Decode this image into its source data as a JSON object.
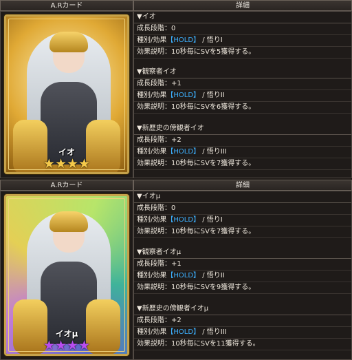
{
  "sections": [
    {
      "left_header": "A.Rカード",
      "right_header": "詳細",
      "card": {
        "name": "イオ",
        "star_count": 4,
        "star_color": "#f4c94a",
        "stars": "★★★★",
        "bg": "gold"
      },
      "details": [
        {
          "title": "▼イオ",
          "growth": "成長段階：0",
          "type_prefix": "種別/効果",
          "type_hold": "【HOLD】",
          "type_suffix": " / 悟りI",
          "effect": "効果説明：10秒毎にSVを5獲得する。"
        },
        {
          "title": "▼観察者イオ",
          "growth": "成長段階：+1",
          "type_prefix": "種別/効果",
          "type_hold": "【HOLD】",
          "type_suffix": " / 悟りII",
          "effect": "効果説明：10秒毎にSVを6獲得する。"
        },
        {
          "title": "▼新歴史の傍観者イオ",
          "growth": "成長段階：+2",
          "type_prefix": "種別/効果",
          "type_hold": "【HOLD】",
          "type_suffix": " / 悟りIII",
          "effect": "効果説明：10秒毎にSVを7獲得する。"
        }
      ]
    },
    {
      "left_header": "A.Rカード",
      "right_header": "詳細",
      "card": {
        "name": "イオμ",
        "star_count": 4,
        "star_color": "#b84df0",
        "stars": "★★★★",
        "bg": "prism"
      },
      "details": [
        {
          "title": "▼イオμ",
          "growth": "成長段階：0",
          "type_prefix": "種別/効果",
          "type_hold": "【HOLD】",
          "type_suffix": " / 悟りI",
          "effect": "効果説明：10秒毎にSVを7獲得する。"
        },
        {
          "title": "▼観察者イオμ",
          "growth": "成長段階：+1",
          "type_prefix": "種別/効果",
          "type_hold": "【HOLD】",
          "type_suffix": " / 悟りII",
          "effect": "効果説明：10秒毎にSVを9獲得する。"
        },
        {
          "title": "▼新歴史の傍観者イオμ",
          "growth": "成長段階：+2",
          "type_prefix": "種別/効果",
          "type_hold": "【HOLD】",
          "type_suffix": " / 悟りIII",
          "effect": "効果説明：10秒毎にSVを11獲得する。"
        }
      ]
    }
  ],
  "colors": {
    "hold": "#3db1ff",
    "frame_gold": "#c6a24a"
  }
}
